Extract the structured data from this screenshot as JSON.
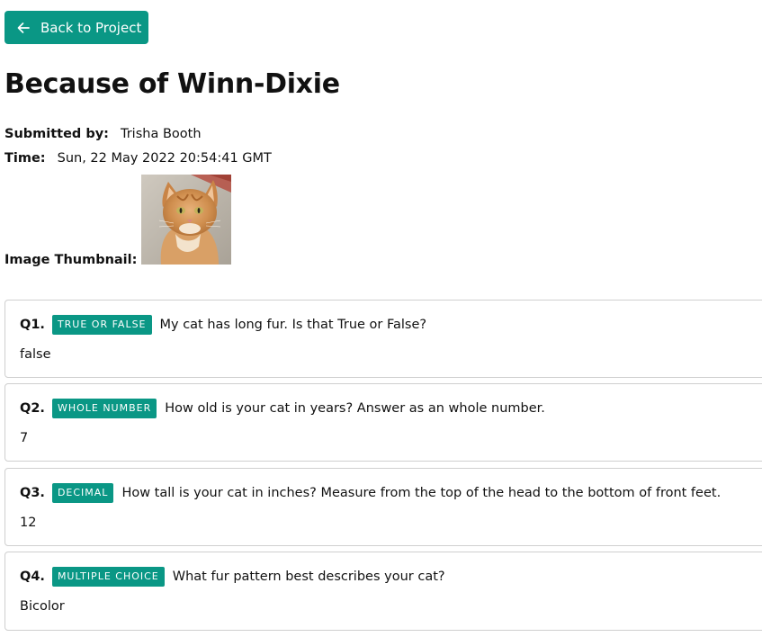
{
  "back_button": {
    "label": "Back to Project",
    "icon": "arrow-left-icon",
    "color": "#0a9785"
  },
  "title": "Because of Winn-Dixie",
  "meta": {
    "submitted_by_label": "Submitted by:",
    "submitted_by": "Trisha Booth",
    "time_label": "Time:",
    "time": "Sun, 22 May 2022 20:54:41 GMT",
    "thumbnail_label": "Image Thumbnail:"
  },
  "questions": [
    {
      "number": "Q1.",
      "type": "TRUE OR FALSE",
      "text": "My cat has long fur. Is that True or False?",
      "answer": "false"
    },
    {
      "number": "Q2.",
      "type": "WHOLE NUMBER",
      "text": "How old is your cat in years? Answer as an whole number.",
      "answer": "7"
    },
    {
      "number": "Q3.",
      "type": "DECIMAL",
      "text": "How tall is your cat in inches? Measure from the top of the head to the bottom of front feet.",
      "answer": "12"
    },
    {
      "number": "Q4.",
      "type": "MULTIPLE CHOICE",
      "text": "What fur pattern best describes your cat?",
      "answer": "Bicolor"
    }
  ],
  "colors": {
    "accent": "#0a9785",
    "card_border": "#cfcfcf"
  }
}
